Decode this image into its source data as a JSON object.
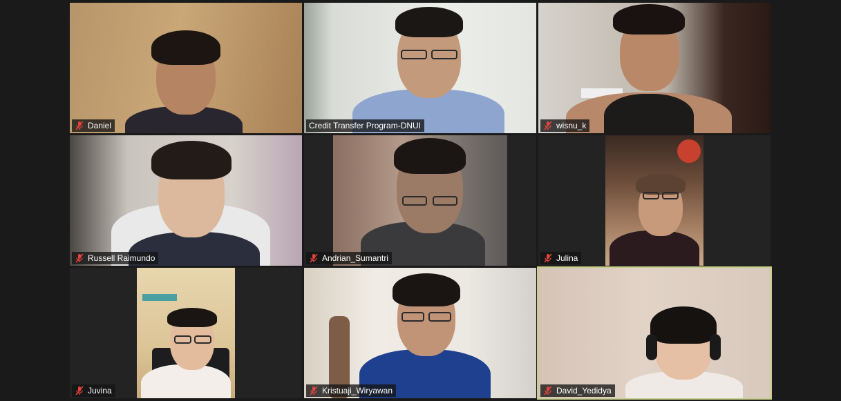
{
  "meeting": {
    "participants": [
      {
        "name": "Daniel",
        "muted": true
      },
      {
        "name": "Credit Transfer Program-DNUI",
        "muted": false
      },
      {
        "name": "wisnu_k",
        "muted": true
      },
      {
        "name": "Russell Raimundo",
        "muted": true
      },
      {
        "name": "Andrian_Sumantri",
        "muted": true
      },
      {
        "name": "Julina",
        "muted": true
      },
      {
        "name": "Juvina",
        "muted": true
      },
      {
        "name": "Kristuaji_Wiryawan",
        "muted": true
      },
      {
        "name": "David_Yedidya",
        "muted": true,
        "active_speaker": true
      }
    ]
  },
  "icons": {
    "muted_mic": "mic-muted-icon"
  },
  "colors": {
    "background": "#1a1a1a",
    "tile_background": "#232323",
    "active_speaker_border": "#c6cf8a",
    "muted_icon": "#e0443c"
  }
}
